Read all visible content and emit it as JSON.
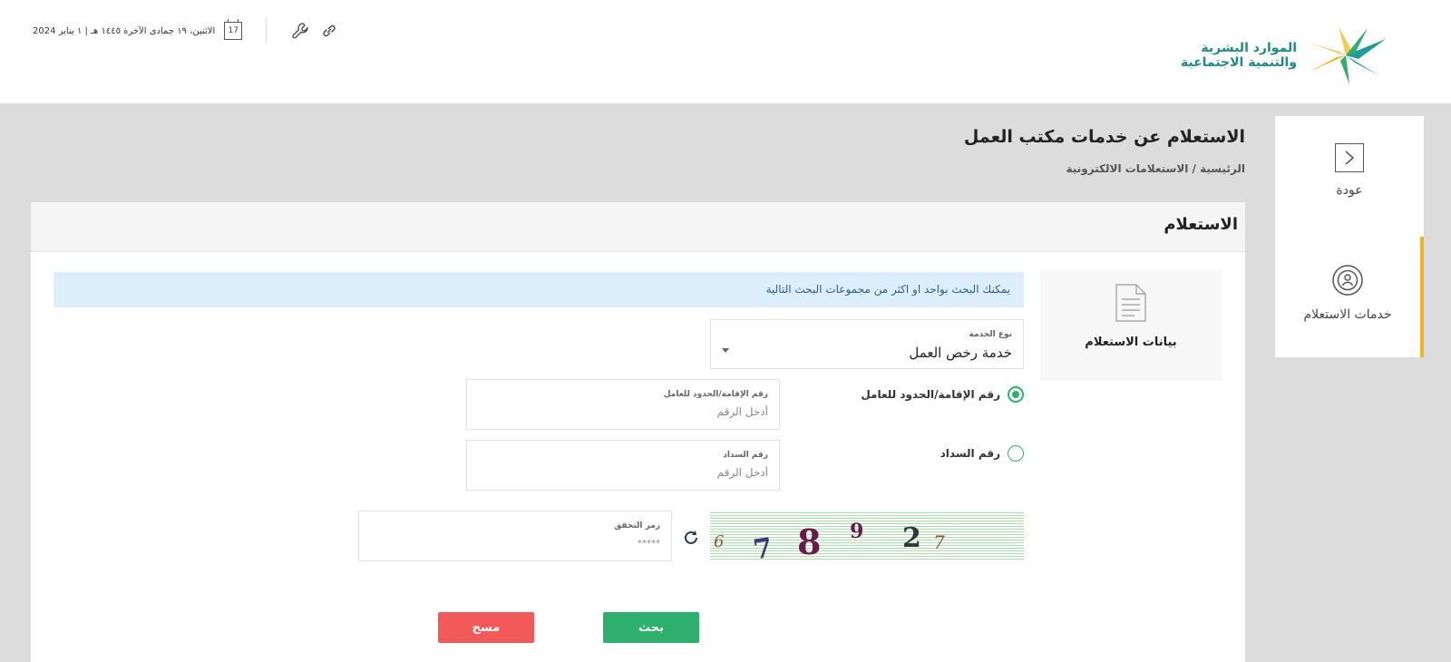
{
  "header": {
    "logo_line1": "الموارد البشرية",
    "logo_line2": "والتنمية الاجتماعية",
    "date_text": "الاثنين، ١٩ جمادى الآخرة ١٤٤٥ هـ | ١ يناير 2024",
    "calendar_day": "17"
  },
  "side_menu": {
    "items": [
      {
        "label": "عودة",
        "icon": "chevron-right-icon"
      },
      {
        "label": "خدمات الاستعلام",
        "icon": "inquiry-services-icon"
      }
    ]
  },
  "page": {
    "title": "الاستعلام عن خدمات مكتب العمل",
    "breadcrumb": "الرئيسية / الاستعلامات الالكترونية"
  },
  "card": {
    "title": "الاستعلام",
    "data_panel_label": "بيانات الاستعلام",
    "info_message": "يمكنك البحث بواحد او اكثر من مجموعات البحث التالية",
    "service_type": {
      "label": "نوع الخدمة",
      "value": "خدمة رخص العمل"
    },
    "radio_options": [
      {
        "label": "رقم الإقامة/الحدود للعامل",
        "selected": true
      },
      {
        "label": "رقم السداد",
        "selected": false
      }
    ],
    "iqama_field": {
      "label": "رقم الإقامة/الحدود للعامل",
      "placeholder": "أدخل الرقم"
    },
    "sadad_field": {
      "label": "رقم السداد",
      "placeholder": "أدخل الرقم"
    },
    "captcha_field": {
      "label": "رمز التحقق",
      "placeholder": "*****"
    },
    "captcha_chars": [
      "6",
      "7",
      "8",
      "9",
      "2",
      "7"
    ],
    "search_button": "بحث",
    "clear_button": "مسح"
  },
  "colors": {
    "accent_green": "#2eaf6d",
    "danger_red": "#f25a5a",
    "active_marker": "#f0b323",
    "info_bg": "#dbeefa"
  }
}
